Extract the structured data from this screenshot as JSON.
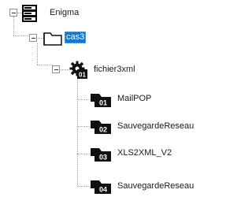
{
  "tree": {
    "root": {
      "label": "Enigma",
      "icon": "server-icon",
      "expanded": true,
      "children": [
        {
          "label": "cas3",
          "icon": "folder-icon",
          "selected": true,
          "expanded": true,
          "children": [
            {
              "label": "fichier3xml",
              "icon": "gear-file-icon",
              "badge": "01",
              "expanded": true,
              "children": [
                {
                  "label": "MailPOP",
                  "icon": "task-icon",
                  "badge": "01"
                },
                {
                  "label": "SauvegardeReseau",
                  "icon": "task-icon",
                  "badge": "02"
                },
                {
                  "label": "XLS2XML_V2",
                  "icon": "task-icon",
                  "badge": "03"
                },
                {
                  "label": "SauvegardeReseau",
                  "icon": "task-icon",
                  "badge": "04"
                }
              ]
            }
          ]
        }
      ]
    }
  },
  "colors": {
    "selection": "#0a7ad8",
    "selection_text": "#ffffff",
    "connector": "#a0a0a0",
    "icon_dark": "#1a1a1a"
  }
}
